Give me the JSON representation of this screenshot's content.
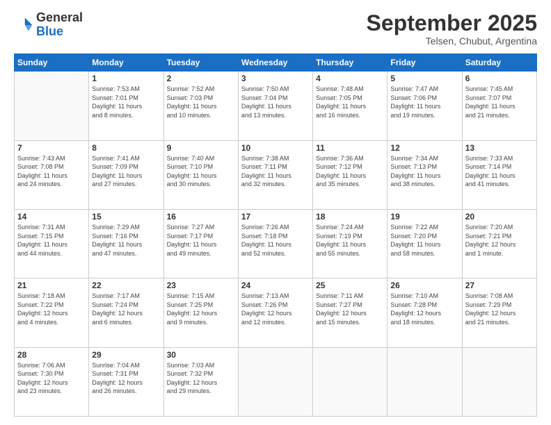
{
  "logo": {
    "general": "General",
    "blue": "Blue"
  },
  "header": {
    "month": "September 2025",
    "location": "Telsen, Chubut, Argentina"
  },
  "days_of_week": [
    "Sunday",
    "Monday",
    "Tuesday",
    "Wednesday",
    "Thursday",
    "Friday",
    "Saturday"
  ],
  "weeks": [
    [
      {
        "day": "",
        "info": ""
      },
      {
        "day": "1",
        "info": "Sunrise: 7:53 AM\nSunset: 7:01 PM\nDaylight: 11 hours\nand 8 minutes."
      },
      {
        "day": "2",
        "info": "Sunrise: 7:52 AM\nSunset: 7:03 PM\nDaylight: 11 hours\nand 10 minutes."
      },
      {
        "day": "3",
        "info": "Sunrise: 7:50 AM\nSunset: 7:04 PM\nDaylight: 11 hours\nand 13 minutes."
      },
      {
        "day": "4",
        "info": "Sunrise: 7:48 AM\nSunset: 7:05 PM\nDaylight: 11 hours\nand 16 minutes."
      },
      {
        "day": "5",
        "info": "Sunrise: 7:47 AM\nSunset: 7:06 PM\nDaylight: 11 hours\nand 19 minutes."
      },
      {
        "day": "6",
        "info": "Sunrise: 7:45 AM\nSunset: 7:07 PM\nDaylight: 11 hours\nand 21 minutes."
      }
    ],
    [
      {
        "day": "7",
        "info": "Sunrise: 7:43 AM\nSunset: 7:08 PM\nDaylight: 11 hours\nand 24 minutes."
      },
      {
        "day": "8",
        "info": "Sunrise: 7:41 AM\nSunset: 7:09 PM\nDaylight: 11 hours\nand 27 minutes."
      },
      {
        "day": "9",
        "info": "Sunrise: 7:40 AM\nSunset: 7:10 PM\nDaylight: 11 hours\nand 30 minutes."
      },
      {
        "day": "10",
        "info": "Sunrise: 7:38 AM\nSunset: 7:11 PM\nDaylight: 11 hours\nand 32 minutes."
      },
      {
        "day": "11",
        "info": "Sunrise: 7:36 AM\nSunset: 7:12 PM\nDaylight: 11 hours\nand 35 minutes."
      },
      {
        "day": "12",
        "info": "Sunrise: 7:34 AM\nSunset: 7:13 PM\nDaylight: 11 hours\nand 38 minutes."
      },
      {
        "day": "13",
        "info": "Sunrise: 7:33 AM\nSunset: 7:14 PM\nDaylight: 11 hours\nand 41 minutes."
      }
    ],
    [
      {
        "day": "14",
        "info": "Sunrise: 7:31 AM\nSunset: 7:15 PM\nDaylight: 11 hours\nand 44 minutes."
      },
      {
        "day": "15",
        "info": "Sunrise: 7:29 AM\nSunset: 7:16 PM\nDaylight: 11 hours\nand 47 minutes."
      },
      {
        "day": "16",
        "info": "Sunrise: 7:27 AM\nSunset: 7:17 PM\nDaylight: 11 hours\nand 49 minutes."
      },
      {
        "day": "17",
        "info": "Sunrise: 7:26 AM\nSunset: 7:18 PM\nDaylight: 11 hours\nand 52 minutes."
      },
      {
        "day": "18",
        "info": "Sunrise: 7:24 AM\nSunset: 7:19 PM\nDaylight: 11 hours\nand 55 minutes."
      },
      {
        "day": "19",
        "info": "Sunrise: 7:22 AM\nSunset: 7:20 PM\nDaylight: 11 hours\nand 58 minutes."
      },
      {
        "day": "20",
        "info": "Sunrise: 7:20 AM\nSunset: 7:21 PM\nDaylight: 12 hours\nand 1 minute."
      }
    ],
    [
      {
        "day": "21",
        "info": "Sunrise: 7:18 AM\nSunset: 7:22 PM\nDaylight: 12 hours\nand 4 minutes."
      },
      {
        "day": "22",
        "info": "Sunrise: 7:17 AM\nSunset: 7:24 PM\nDaylight: 12 hours\nand 6 minutes."
      },
      {
        "day": "23",
        "info": "Sunrise: 7:15 AM\nSunset: 7:25 PM\nDaylight: 12 hours\nand 9 minutes."
      },
      {
        "day": "24",
        "info": "Sunrise: 7:13 AM\nSunset: 7:26 PM\nDaylight: 12 hours\nand 12 minutes."
      },
      {
        "day": "25",
        "info": "Sunrise: 7:11 AM\nSunset: 7:27 PM\nDaylight: 12 hours\nand 15 minutes."
      },
      {
        "day": "26",
        "info": "Sunrise: 7:10 AM\nSunset: 7:28 PM\nDaylight: 12 hours\nand 18 minutes."
      },
      {
        "day": "27",
        "info": "Sunrise: 7:08 AM\nSunset: 7:29 PM\nDaylight: 12 hours\nand 21 minutes."
      }
    ],
    [
      {
        "day": "28",
        "info": "Sunrise: 7:06 AM\nSunset: 7:30 PM\nDaylight: 12 hours\nand 23 minutes."
      },
      {
        "day": "29",
        "info": "Sunrise: 7:04 AM\nSunset: 7:31 PM\nDaylight: 12 hours\nand 26 minutes."
      },
      {
        "day": "30",
        "info": "Sunrise: 7:03 AM\nSunset: 7:32 PM\nDaylight: 12 hours\nand 29 minutes."
      },
      {
        "day": "",
        "info": ""
      },
      {
        "day": "",
        "info": ""
      },
      {
        "day": "",
        "info": ""
      },
      {
        "day": "",
        "info": ""
      }
    ]
  ]
}
